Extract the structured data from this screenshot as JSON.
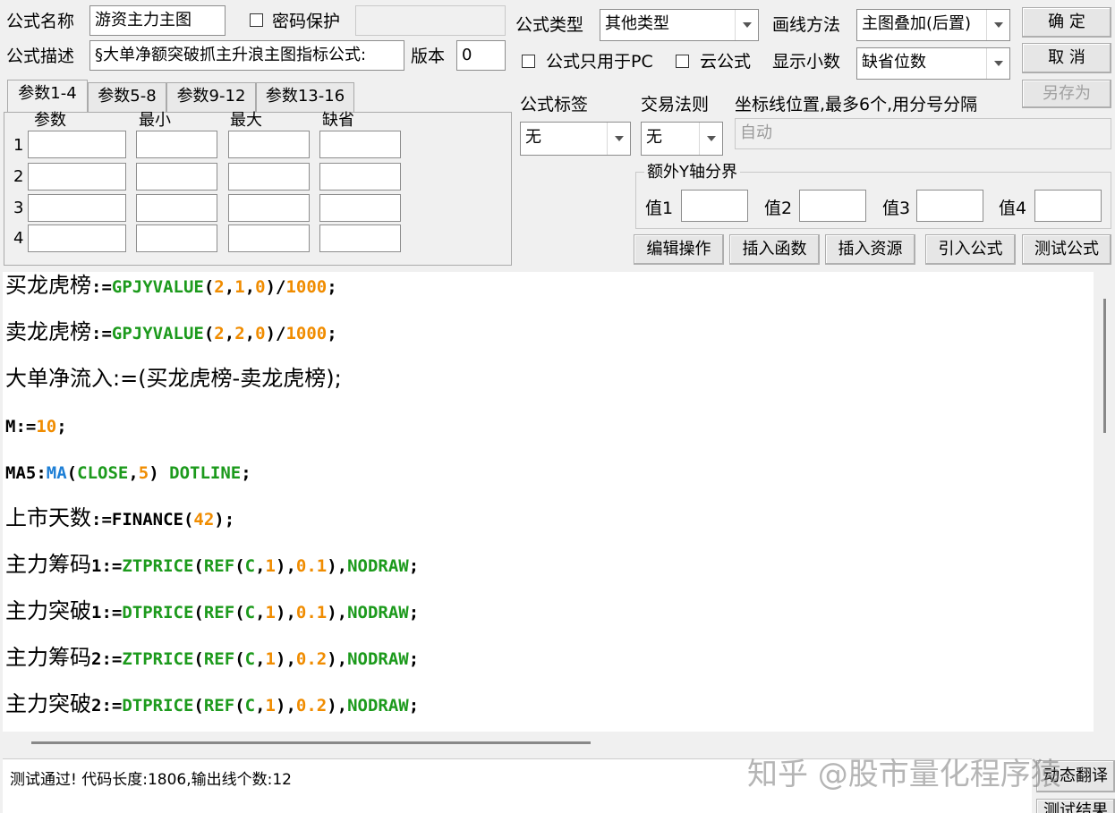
{
  "form": {
    "name_label": "公式名称",
    "name_value": "游资主力主图",
    "password_label": "密码保护",
    "password_value": "",
    "desc_label": "公式描述",
    "desc_value": "§大单净额突破抓主升浪主图指标公式:",
    "version_label": "版本",
    "version_value": "0",
    "type_label": "公式类型",
    "type_value": "其他类型",
    "draw_label": "画线方法",
    "draw_value": "主图叠加(后置)",
    "pc_only_label": "公式只用于PC",
    "cloud_label": "云公式",
    "decimals_label": "显示小数",
    "decimals_value": "缺省位数",
    "tag_label": "公式标签",
    "tag_value": "无",
    "rule_label": "交易法则",
    "rule_value": "无",
    "coord_label": "坐标线位置,最多6个,用分号分隔",
    "coord_value": "自动",
    "yaxis_group": "额外Y轴分界",
    "yaxis_values": [
      "值1",
      "值2",
      "值3",
      "值4"
    ]
  },
  "buttons": {
    "ok": "确 定",
    "cancel": "取 消",
    "save_as": "另存为",
    "edit_op": "编辑操作",
    "insert_func": "插入函数",
    "insert_res": "插入资源",
    "import_formula": "引入公式",
    "test_formula": "测试公式",
    "bottom_partial_1": "动态翻译",
    "bottom_partial_2": "测试结果"
  },
  "tabs": [
    "参数1-4",
    "参数5-8",
    "参数9-12",
    "参数13-16"
  ],
  "param_table": {
    "headers": [
      "参数",
      "最小",
      "最大",
      "缺省"
    ],
    "rows": [
      "1",
      "2",
      "3",
      "4"
    ]
  },
  "code_lines": [
    [
      [
        "k",
        "买龙虎榜"
      ],
      [
        "k",
        ":="
      ],
      [
        "g",
        "GPJYVALUE"
      ],
      [
        "k",
        "("
      ],
      [
        "o",
        "2"
      ],
      [
        "k",
        ","
      ],
      [
        "o",
        "1"
      ],
      [
        "k",
        ","
      ],
      [
        "o",
        "0"
      ],
      [
        "k",
        ")/"
      ],
      [
        "o",
        "1000"
      ],
      [
        "k",
        ";"
      ]
    ],
    [
      [
        "k",
        "卖龙虎榜"
      ],
      [
        "k",
        ":="
      ],
      [
        "g",
        "GPJYVALUE"
      ],
      [
        "k",
        "("
      ],
      [
        "o",
        "2"
      ],
      [
        "k",
        ","
      ],
      [
        "o",
        "2"
      ],
      [
        "k",
        ","
      ],
      [
        "o",
        "0"
      ],
      [
        "k",
        ")/"
      ],
      [
        "o",
        "1000"
      ],
      [
        "k",
        ";"
      ]
    ],
    [
      [
        "k",
        "大单净流入"
      ],
      [
        "k",
        ":=(买龙虎榜-卖龙虎榜);"
      ]
    ],
    [
      [
        "k",
        "M"
      ],
      [
        "k",
        ":="
      ],
      [
        "o",
        "10"
      ],
      [
        "k",
        ";"
      ]
    ],
    [
      [
        "k",
        "MA5"
      ],
      [
        "k",
        ":"
      ],
      [
        "b",
        "MA"
      ],
      [
        "k",
        "("
      ],
      [
        "g",
        "CLOSE"
      ],
      [
        "k",
        ","
      ],
      [
        "o",
        "5"
      ],
      [
        "k",
        ") "
      ],
      [
        "g",
        "DOTLINE"
      ],
      [
        "k",
        ";"
      ]
    ],
    [
      [
        "k",
        "上市天数"
      ],
      [
        "k",
        ":=FINANCE("
      ],
      [
        "o",
        "42"
      ],
      [
        "k",
        ");"
      ]
    ],
    [
      [
        "k",
        "主力筹码"
      ],
      [
        "k",
        "1:="
      ],
      [
        "g",
        "ZTPRICE"
      ],
      [
        "k",
        "("
      ],
      [
        "g",
        "REF"
      ],
      [
        "k",
        "("
      ],
      [
        "g",
        "C"
      ],
      [
        "k",
        ","
      ],
      [
        "o",
        "1"
      ],
      [
        "k",
        "),"
      ],
      [
        "o",
        "0.1"
      ],
      [
        "k",
        "),"
      ],
      [
        "g",
        "NODRAW"
      ],
      [
        "k",
        ";"
      ]
    ],
    [
      [
        "k",
        "主力突破"
      ],
      [
        "k",
        "1:="
      ],
      [
        "g",
        "DTPRICE"
      ],
      [
        "k",
        "("
      ],
      [
        "g",
        "REF"
      ],
      [
        "k",
        "("
      ],
      [
        "g",
        "C"
      ],
      [
        "k",
        ","
      ],
      [
        "o",
        "1"
      ],
      [
        "k",
        "),"
      ],
      [
        "o",
        "0.1"
      ],
      [
        "k",
        "),"
      ],
      [
        "g",
        "NODRAW"
      ],
      [
        "k",
        ";"
      ]
    ],
    [
      [
        "k",
        "主力筹码"
      ],
      [
        "k",
        "2:="
      ],
      [
        "g",
        "ZTPRICE"
      ],
      [
        "k",
        "("
      ],
      [
        "g",
        "REF"
      ],
      [
        "k",
        "("
      ],
      [
        "g",
        "C"
      ],
      [
        "k",
        ","
      ],
      [
        "o",
        "1"
      ],
      [
        "k",
        "),"
      ],
      [
        "o",
        "0.2"
      ],
      [
        "k",
        "),"
      ],
      [
        "g",
        "NODRAW"
      ],
      [
        "k",
        ";"
      ]
    ],
    [
      [
        "k",
        "主力突破"
      ],
      [
        "k",
        "2:="
      ],
      [
        "g",
        "DTPRICE"
      ],
      [
        "k",
        "("
      ],
      [
        "g",
        "REF"
      ],
      [
        "k",
        "("
      ],
      [
        "g",
        "C"
      ],
      [
        "k",
        ","
      ],
      [
        "o",
        "1"
      ],
      [
        "k",
        "),"
      ],
      [
        "o",
        "0.2"
      ],
      [
        "k",
        "),"
      ],
      [
        "g",
        "NODRAW"
      ],
      [
        "k",
        ";"
      ]
    ]
  ],
  "status": "测试通过! 代码长度:1806,输出线个数:12",
  "watermark": "知乎 @股市量化程序猿"
}
